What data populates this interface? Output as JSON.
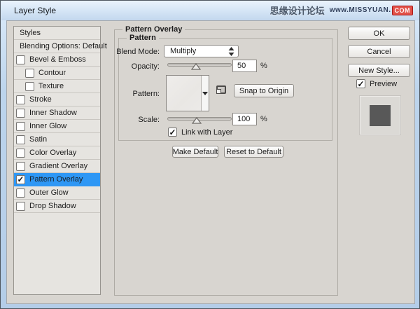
{
  "window": {
    "title": "Layer Style"
  },
  "watermark": {
    "site_name": "思缘设计论坛",
    "url_prefix": "www.MISSYUAN.",
    "url_suffix": "COM"
  },
  "sidebar": {
    "header": "Styles",
    "blending_row": "Blending Options: Default",
    "items": [
      {
        "label": "Bevel & Emboss",
        "checked": false,
        "indent": false,
        "selected": false
      },
      {
        "label": "Contour",
        "checked": false,
        "indent": true,
        "selected": false
      },
      {
        "label": "Texture",
        "checked": false,
        "indent": true,
        "selected": false
      },
      {
        "label": "Stroke",
        "checked": false,
        "indent": false,
        "selected": false
      },
      {
        "label": "Inner Shadow",
        "checked": false,
        "indent": false,
        "selected": false
      },
      {
        "label": "Inner Glow",
        "checked": false,
        "indent": false,
        "selected": false
      },
      {
        "label": "Satin",
        "checked": false,
        "indent": false,
        "selected": false
      },
      {
        "label": "Color Overlay",
        "checked": false,
        "indent": false,
        "selected": false
      },
      {
        "label": "Gradient Overlay",
        "checked": false,
        "indent": false,
        "selected": false
      },
      {
        "label": "Pattern Overlay",
        "checked": true,
        "indent": false,
        "selected": true
      },
      {
        "label": "Outer Glow",
        "checked": false,
        "indent": false,
        "selected": false
      },
      {
        "label": "Drop Shadow",
        "checked": false,
        "indent": false,
        "selected": false
      }
    ]
  },
  "panel": {
    "group_title": "Pattern Overlay",
    "subgroup_title": "Pattern",
    "blend_mode": {
      "label": "Blend Mode:",
      "value": "Multiply"
    },
    "opacity": {
      "label": "Opacity:",
      "value": "50",
      "unit": "%",
      "slider_pct": 45
    },
    "pattern": {
      "label": "Pattern:",
      "snap_button": "Snap to Origin"
    },
    "scale": {
      "label": "Scale:",
      "value": "100",
      "unit": "%",
      "slider_pct": 46
    },
    "link_with_layer": {
      "label": "Link with Layer",
      "checked": true
    },
    "make_default": "Make Default",
    "reset_default": "Reset to Default"
  },
  "actions": {
    "ok": "OK",
    "cancel": "Cancel",
    "new_style": "New Style...",
    "preview": {
      "label": "Preview",
      "checked": true
    }
  },
  "colors": {
    "selection_blue": "#2e97f5",
    "swatch_dark": "#585858",
    "badge_red": "#e25148",
    "dialog_bg": "#d8d5d0",
    "titlebar_blue": "#cfe0f2"
  }
}
